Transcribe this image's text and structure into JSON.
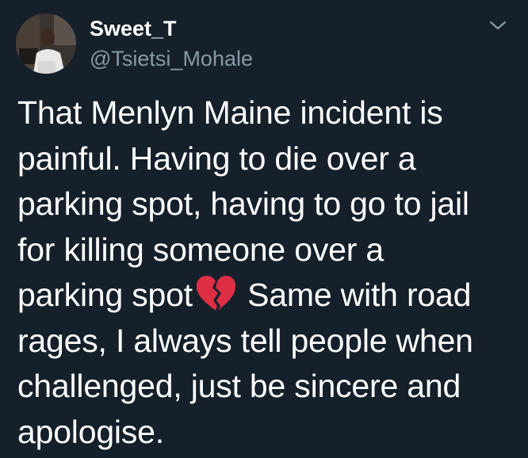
{
  "tweet": {
    "display_name": "Sweet_T",
    "handle": "@Tsietsi_Mohale",
    "lines": [
      "That Menlyn Maine incident is",
      "painful. Having to die over a",
      "parking spot, having to go to jail",
      "for killing someone over a"
    ],
    "line5_before_emoji": "parking spot",
    "emoji": "broken-heart-icon",
    "line5_after_emoji": " Same with road",
    "lines_after": [
      "rages, I always tell people when",
      "challenged, just be sincere and",
      "apologise."
    ]
  },
  "colors": {
    "background": "#15202b",
    "text": "#ffffff",
    "secondary_text": "#8899a6",
    "emoji_red": "#dd2e44"
  }
}
